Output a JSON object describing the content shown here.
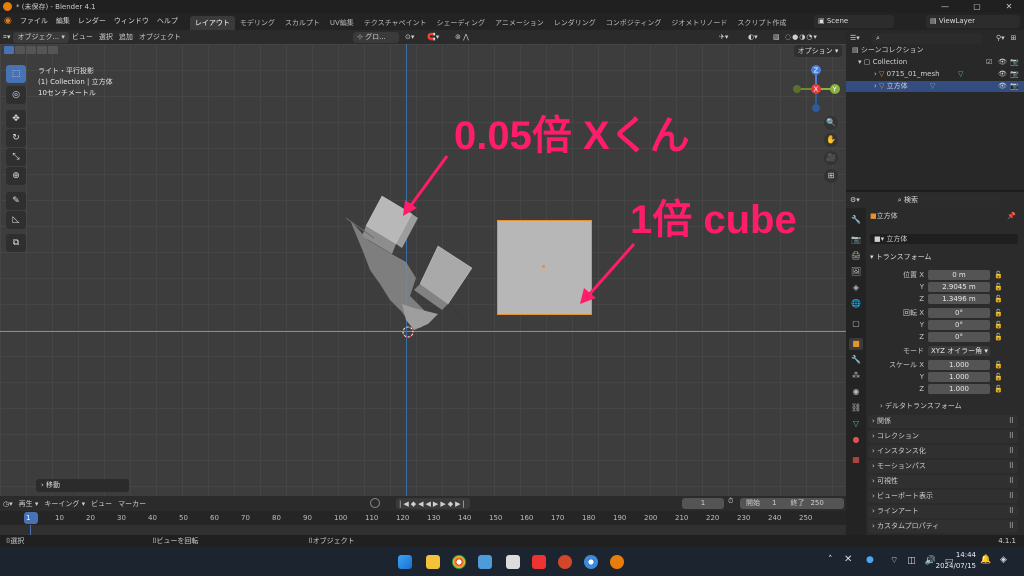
{
  "window": {
    "title": "* (未保存) - Blender 4.1",
    "min": "—",
    "max": "▢",
    "close": "✕"
  },
  "menu": {
    "items": [
      "ファイル",
      "編集",
      "レンダー",
      "ウィンドウ",
      "ヘルプ"
    ],
    "workspaces": [
      "レイアウト",
      "モデリング",
      "スカルプト",
      "UV編集",
      "テクスチャペイント",
      "シェーディング",
      "アニメーション",
      "レンダリング",
      "コンポジティング",
      "ジオメトリノード",
      "スクリプト作成"
    ],
    "scene": "Scene",
    "view_layer": "ViewLayer"
  },
  "viewport_header": {
    "mode": "オブジェク...",
    "items": [
      "ビュー",
      "選択",
      "追加",
      "オブジェクト"
    ],
    "transform": "グロ...",
    "options": "オプション"
  },
  "viewport": {
    "info_line1": "ライト・平行投影",
    "info_line2": "(1) Collection | 立方体",
    "info_line3": "10センチメートル",
    "last_op": "移動",
    "annot_small": "0.05倍 Xくん",
    "annot_big": "1倍 cube",
    "gizmo": {
      "z": "Z",
      "y": "Y",
      "x": "X"
    }
  },
  "outliner": {
    "search": "",
    "root": "シーンコレクション",
    "collection": "Collection",
    "items": [
      "0715_01_mesh",
      "立方体"
    ]
  },
  "properties": {
    "search": "検索",
    "object_name": "立方体",
    "object_field": "立方体",
    "transform_title": "トランスフォーム",
    "location_label": "位置 X",
    "rotation_label": "回転 X",
    "mode_label": "モード",
    "scale_label": "スケール X",
    "axis_y": "Y",
    "axis_z": "Z",
    "location": [
      "0 m",
      "2.9045 m",
      "1.3496 m"
    ],
    "rotation": [
      "0°",
      "0°",
      "0°"
    ],
    "mode": "XYZ オイラー角",
    "scale": [
      "1.000",
      "1.000",
      "1.000"
    ],
    "sections": [
      "デルタトランスフォーム",
      "関係",
      "コレクション",
      "インスタンス化",
      "モーションパス",
      "可視性",
      "ビューポート表示",
      "ラインアート",
      "カスタムプロパティ"
    ]
  },
  "timeline": {
    "items": [
      "再生",
      "キーイング",
      "ビュー",
      "マーカー"
    ],
    "current_frame": "1",
    "start_label": "開始",
    "start": "1",
    "end_label": "終了",
    "end": "250",
    "ticks": [
      "1",
      "10",
      "20",
      "30",
      "40",
      "50",
      "60",
      "70",
      "80",
      "90",
      "100",
      "110",
      "120",
      "130",
      "140",
      "150",
      "160",
      "170",
      "180",
      "190",
      "200",
      "210",
      "220",
      "230",
      "240",
      "250"
    ]
  },
  "status": {
    "select": "選択",
    "rotate": "ビューを回転",
    "object": "オブジェクト",
    "version": "4.1.1"
  },
  "taskbar": {
    "time": "14:44",
    "date": "2024/07/15"
  },
  "colors": {
    "accent": "#4772b3",
    "annotation": "#ff1c6b",
    "selection": "#e8922e"
  }
}
